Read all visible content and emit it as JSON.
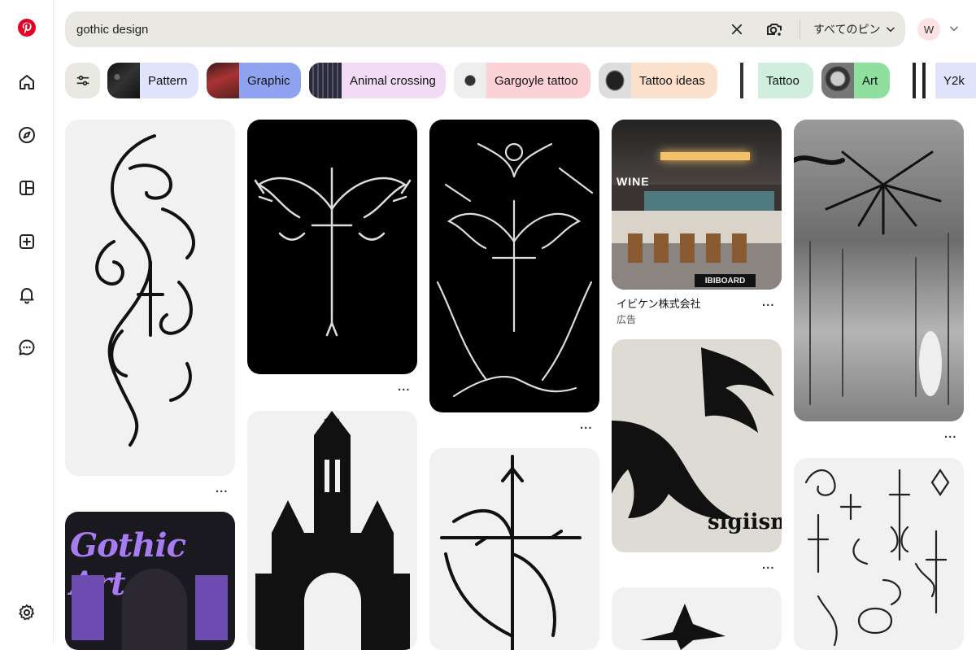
{
  "search": {
    "query": "gothic design",
    "scope": "すべてのピン"
  },
  "account": {
    "initial": "W"
  },
  "chips": [
    {
      "label": "Pattern",
      "bg": "#dfe3fb"
    },
    {
      "label": "Graphic",
      "bg": "#8fa3f0"
    },
    {
      "label": "Animal crossing",
      "bg": "#f2dbf5"
    },
    {
      "label": "Gargoyle tattoo",
      "bg": "#fbd3d6"
    },
    {
      "label": "Tattoo ideas",
      "bg": "#fbe0cc"
    },
    {
      "label": "Tattoo",
      "bg": "#cfeede"
    },
    {
      "label": "Art",
      "bg": "#8fe09e"
    },
    {
      "label": "Y2k",
      "bg": "#dfe3fb"
    }
  ],
  "pins": {
    "more_label": "...",
    "ad": {
      "advertiser": "イビケン株式会社",
      "tag": "広告",
      "sign_text": "WINE",
      "board_text": "IBIBOARD"
    },
    "gothic_art_title": "Gothic Art",
    "sigism_text": "sigiism"
  },
  "colors": {
    "brand": "#e60023",
    "search_bg": "#e9e9e2"
  }
}
